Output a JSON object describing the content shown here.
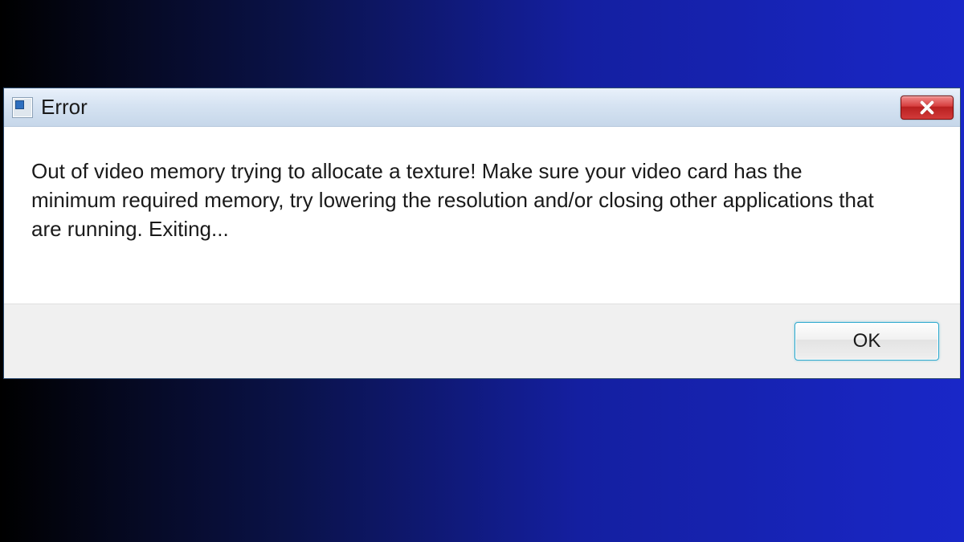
{
  "dialog": {
    "title": "Error",
    "message": "Out of video memory trying to allocate a texture! Make sure your video card has the minimum required memory, try lowering the resolution and/or closing other applications that are running. Exiting...",
    "ok_label": "OK"
  }
}
